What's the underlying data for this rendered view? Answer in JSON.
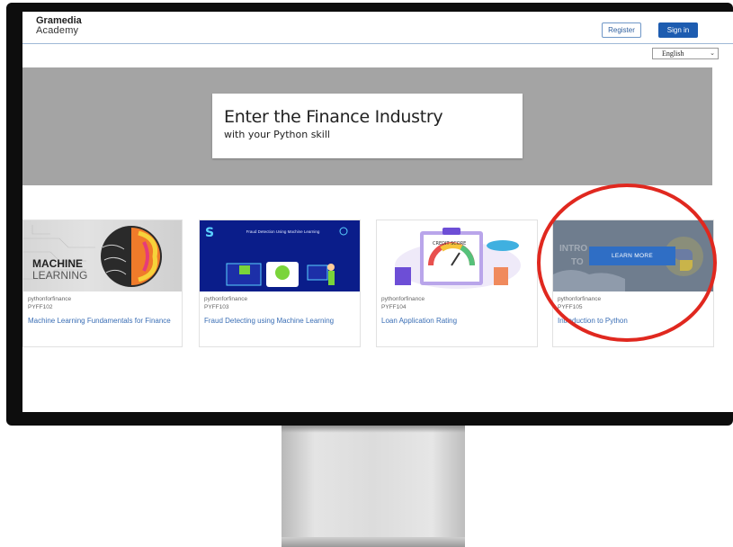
{
  "header": {
    "logo_brand": "Gramedia",
    "logo_sub": "Academy",
    "register_label": "Register",
    "signin_label": "Sign in"
  },
  "language": {
    "selected": "English"
  },
  "hero": {
    "title": "Enter the Finance Industry",
    "subtitle": "with your Python skill"
  },
  "courses": [
    {
      "org": "pythonforfinance",
      "code": "PYFF102",
      "title": "Machine Learning Fundamentals for Finance",
      "image_text": [
        "MACHINE",
        "LEARNING"
      ]
    },
    {
      "org": "pythonforfinance",
      "code": "PYFF103",
      "title": "Fraud Detecting using Machine Learning",
      "image_text": [
        "Fraud Detection Using Machine Learning"
      ]
    },
    {
      "org": "pythonforfinance",
      "code": "PYFF104",
      "title": "Loan Application Rating",
      "image_text": [
        "CREDIT SCORE"
      ]
    },
    {
      "org": "pythonforfinance",
      "code": "PYFF105",
      "title": "Introduction to Python",
      "hover_button": "LEARN MORE",
      "image_text": [
        "INTRO",
        "TO"
      ]
    }
  ],
  "colors": {
    "primary": "#1d5cb0",
    "link": "#3a6eb5",
    "hero_bg": "#a4a4a4",
    "annotation": "#e0281f"
  },
  "icons": [
    "chevron-down-icon",
    "brain-illustration",
    "python-logo-icon",
    "gauge-illustration"
  ]
}
